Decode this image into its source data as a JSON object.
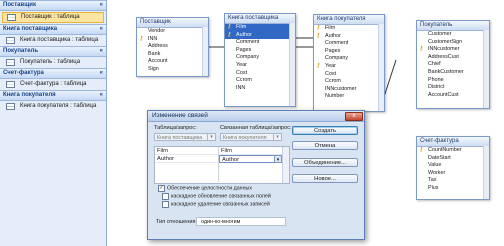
{
  "nav": {
    "groups": [
      {
        "title": "Поставщик",
        "items": [
          {
            "label": "Поставщик : таблица",
            "selected": true
          }
        ]
      },
      {
        "title": "Книга поставщика",
        "items": [
          {
            "label": "Книга поставщика : таблица",
            "selected": false
          }
        ]
      },
      {
        "title": "Покупатель",
        "items": [
          {
            "label": "Покупатель : таблица",
            "selected": false
          }
        ]
      },
      {
        "title": "Счет-фактура",
        "items": [
          {
            "label": "Счет-фактура : таблица",
            "selected": false
          }
        ]
      },
      {
        "title": "Книга покупателя",
        "items": [
          {
            "label": "Книга покупателя : таблица",
            "selected": false
          }
        ]
      }
    ]
  },
  "tables": {
    "supplier": {
      "title": "Поставщик",
      "fields": [
        {
          "name": "Vendor",
          "key": false
        },
        {
          "name": "INN",
          "key": true
        },
        {
          "name": "Address",
          "key": false
        },
        {
          "name": "Bank",
          "key": false
        },
        {
          "name": "Account",
          "key": false
        },
        {
          "name": "Sign",
          "key": false
        }
      ]
    },
    "supplier_book": {
      "title": "Книга поставщика",
      "fields": [
        {
          "name": "Film",
          "key": true,
          "hl": true
        },
        {
          "name": "Author",
          "key": true,
          "hl": true
        },
        {
          "name": "Comment",
          "key": false
        },
        {
          "name": "Pages",
          "key": false
        },
        {
          "name": "Company",
          "key": false
        },
        {
          "name": "Year",
          "key": false
        },
        {
          "name": "Cost",
          "key": false
        },
        {
          "name": "Ccrom",
          "key": false
        },
        {
          "name": "INN",
          "key": false
        }
      ]
    },
    "customer_book": {
      "title": "Книга покупателя",
      "fields": [
        {
          "name": "Film",
          "key": true
        },
        {
          "name": "Author",
          "key": true
        },
        {
          "name": "Comment",
          "key": false
        },
        {
          "name": "Pages",
          "key": false
        },
        {
          "name": "Company",
          "key": false
        },
        {
          "name": "Year",
          "key": true
        },
        {
          "name": "Cost",
          "key": false
        },
        {
          "name": "Ccrom",
          "key": false
        },
        {
          "name": "INNcustomer",
          "key": false
        },
        {
          "name": "Number",
          "key": false
        }
      ]
    },
    "customer": {
      "title": "Покупатель",
      "fields": [
        {
          "name": "Customer",
          "key": false
        },
        {
          "name": "CustomerSign",
          "key": false
        },
        {
          "name": "INNcustomer",
          "key": true
        },
        {
          "name": "AddressCust",
          "key": false
        },
        {
          "name": "Chief",
          "key": false
        },
        {
          "name": "BankCustomer",
          "key": false
        },
        {
          "name": "Phone",
          "key": false
        },
        {
          "name": "District",
          "key": false
        },
        {
          "name": "AccountCust",
          "key": false
        }
      ]
    },
    "invoice": {
      "title": "Счет-фактура",
      "fields": [
        {
          "name": "CountNumber",
          "key": true
        },
        {
          "name": "DateStart",
          "key": false
        },
        {
          "name": "Value",
          "key": false
        },
        {
          "name": "Worker",
          "key": false
        },
        {
          "name": "Tax",
          "key": false
        },
        {
          "name": "Plus",
          "key": false
        }
      ]
    }
  },
  "dialog": {
    "title": "Изменение связей",
    "close": "x",
    "table_label": "Таблица/запрос:",
    "related_label": "Связанная таблица/запрос:",
    "table_value": "Книга поставщика",
    "related_value": "Книга покупателя",
    "grid": [
      {
        "left": "Film",
        "right": "Film"
      },
      {
        "left": "Author",
        "right": "Author"
      }
    ],
    "checkboxes": [
      {
        "label": "Обеспечение целостности данных",
        "checked": true
      },
      {
        "label": "каскадное обновление связанных полей",
        "checked": false
      },
      {
        "label": "каскадное удаление связанных записей",
        "checked": false
      }
    ],
    "buttons": {
      "create": "Создать",
      "cancel": "Отмена",
      "join": "Объединение...",
      "new": "Новое..."
    },
    "reltype_label": "Тип отношения:",
    "reltype_value": "один-ко-многим"
  }
}
